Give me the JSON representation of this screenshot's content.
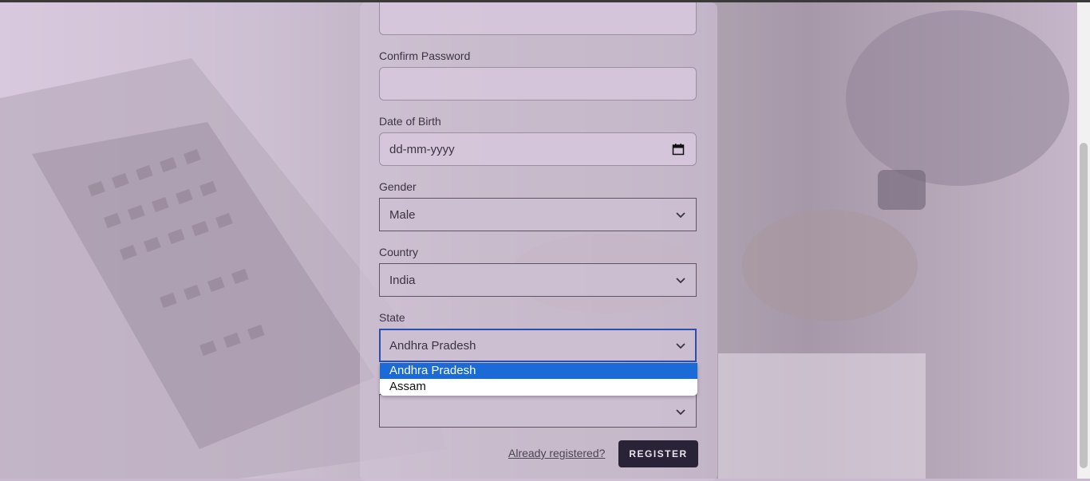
{
  "form": {
    "confirm_password": {
      "label": "Confirm Password",
      "value": ""
    },
    "date_of_birth": {
      "label": "Date of Birth",
      "placeholder": "dd-mm-yyyy",
      "icon": "calendar-icon"
    },
    "gender": {
      "label": "Gender",
      "value": "Male"
    },
    "country": {
      "label": "Country",
      "value": "India"
    },
    "state": {
      "label": "State",
      "value": "Andhra Pradesh",
      "options": [
        {
          "label": "Andhra Pradesh",
          "selected": true
        },
        {
          "label": "Assam",
          "selected": false
        }
      ]
    },
    "city": {
      "value": ""
    },
    "already_registered_link": "Already registered?",
    "register_button": "REGISTER"
  },
  "colors": {
    "accent": "#2b4fb0",
    "option_highlight": "#1a6ad8",
    "button_bg": "#2a2338"
  }
}
